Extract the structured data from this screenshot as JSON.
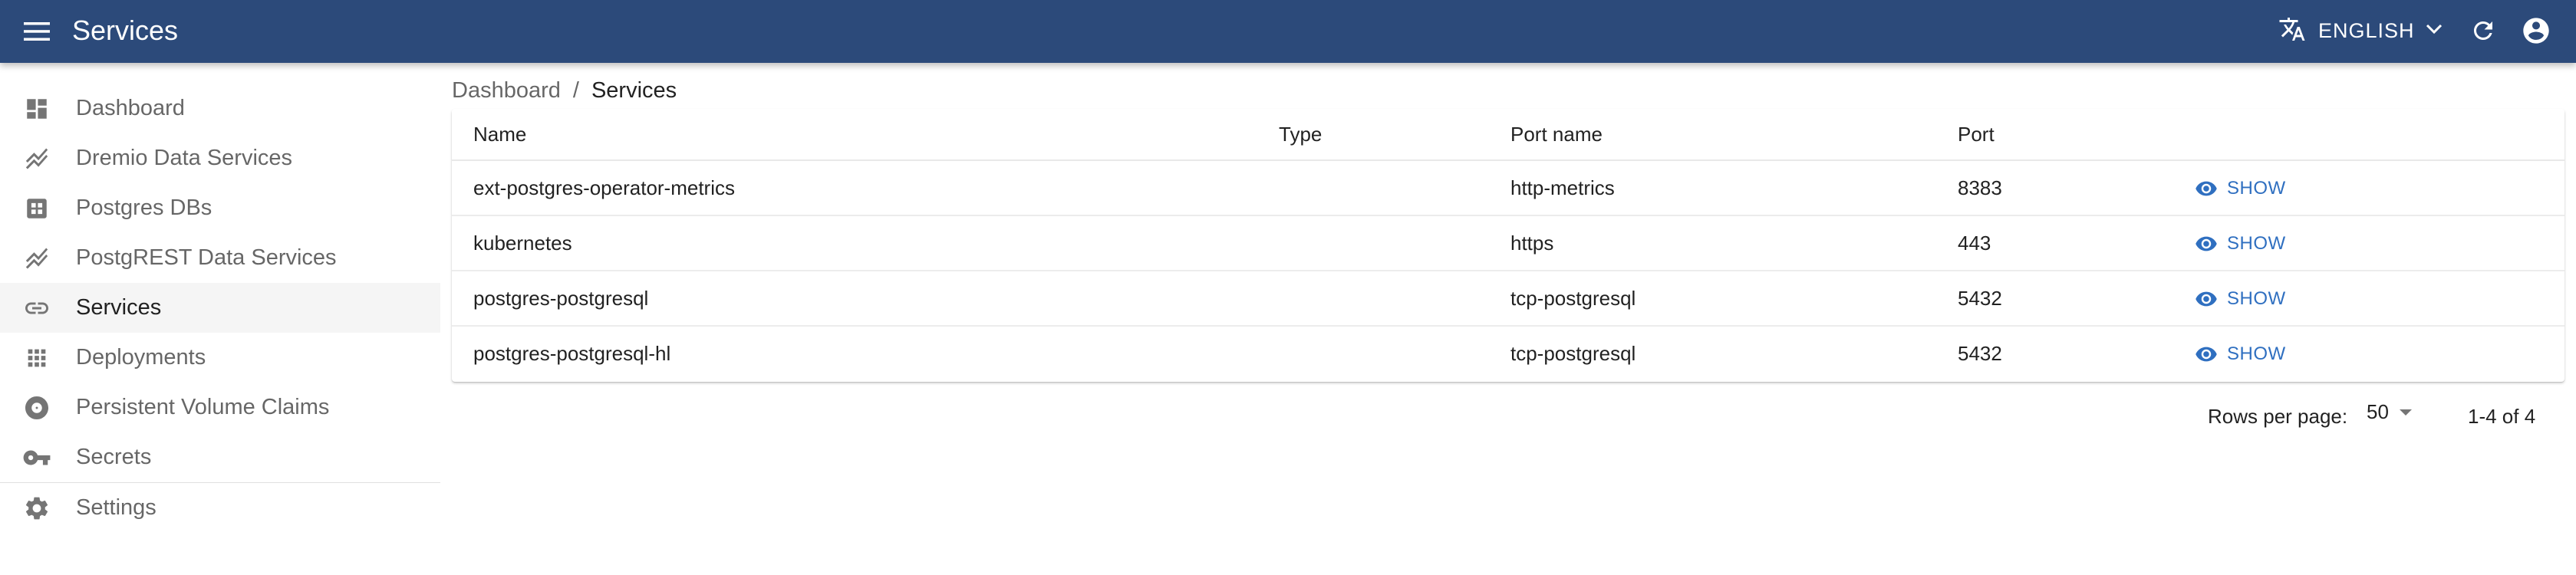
{
  "colors": {
    "appbar": "#2c4a7a",
    "accent": "#2f6fc0"
  },
  "appbar": {
    "title": "Services",
    "language": "ENGLISH",
    "icons": {
      "menu": "menu-icon",
      "translate": "translate-icon",
      "dropdown": "chevron-down-icon",
      "refresh": "refresh-icon",
      "account": "account-circle-icon"
    }
  },
  "sidebar": {
    "items": [
      {
        "label": "Dashboard",
        "icon": "dashboard-icon"
      },
      {
        "label": "Dremio Data Services",
        "icon": "stacked-line-icon"
      },
      {
        "label": "Postgres DBs",
        "icon": "grid-box-icon"
      },
      {
        "label": "PostgREST Data Services",
        "icon": "stacked-line-icon"
      },
      {
        "label": "Services",
        "icon": "link-icon",
        "active": true
      },
      {
        "label": "Deployments",
        "icon": "apps-icon"
      },
      {
        "label": "Persistent Volume Claims",
        "icon": "disc-icon"
      },
      {
        "label": "Secrets",
        "icon": "key-icon"
      },
      {
        "label": "Settings",
        "icon": "gear-icon"
      }
    ]
  },
  "breadcrumb": {
    "parent": "Dashboard",
    "separator": "/",
    "current": "Services"
  },
  "table": {
    "columns": [
      "Name",
      "Type",
      "Port name",
      "Port"
    ],
    "rows": [
      {
        "name": "ext-postgres-operator-metrics",
        "type": "",
        "port_name": "http-metrics",
        "port": "8383",
        "action": "SHOW"
      },
      {
        "name": "kubernetes",
        "type": "",
        "port_name": "https",
        "port": "443",
        "action": "SHOW"
      },
      {
        "name": "postgres-postgresql",
        "type": "",
        "port_name": "tcp-postgresql",
        "port": "5432",
        "action": "SHOW"
      },
      {
        "name": "postgres-postgresql-hl",
        "type": "",
        "port_name": "tcp-postgresql",
        "port": "5432",
        "action": "SHOW"
      }
    ]
  },
  "pagination": {
    "rows_per_page_label": "Rows per page:",
    "rows_per_page": "50",
    "range": "1-4 of 4"
  }
}
